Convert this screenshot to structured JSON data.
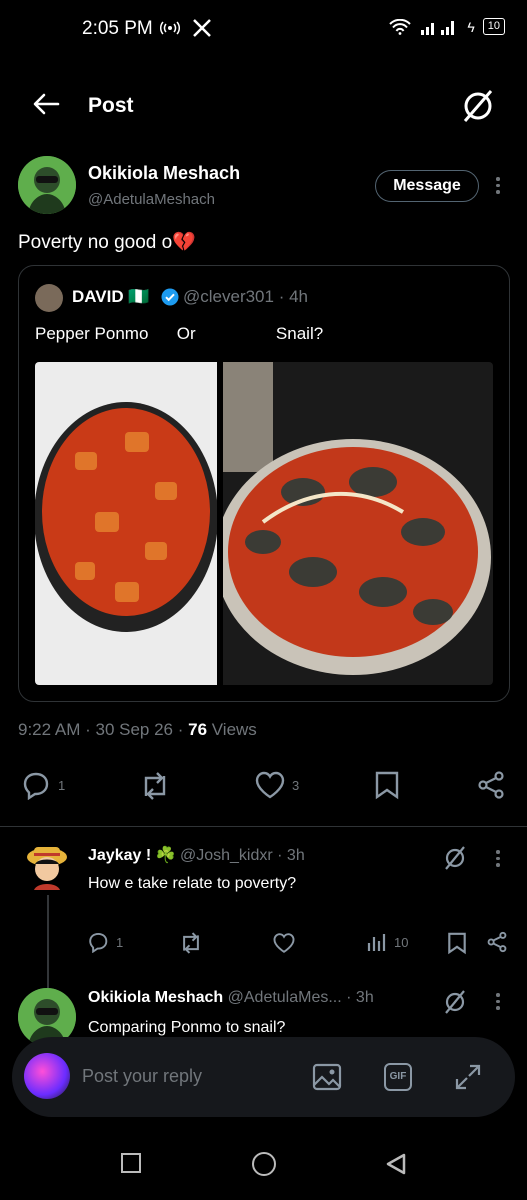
{
  "status_bar": {
    "time": "2:05 PM",
    "battery": "10"
  },
  "header": {
    "title": "Post"
  },
  "post": {
    "author_name": "Okikiola Meshach",
    "author_handle": "@AdetulaMeshach",
    "message_button": "Message",
    "text": "Poverty no good o💔",
    "quote": {
      "name": "DAVID 🇳🇬",
      "handle_time": "@clever301 · 4h",
      "text": "Pepper Ponmo      Or                 Snail?"
    },
    "time": "9:22 AM",
    "date": "30 Sep 26",
    "views_count": "76",
    "views_label": "Views",
    "replies": "1",
    "likes": "3"
  },
  "replies": [
    {
      "name": "Jaykay ! ☘️",
      "handle_time": "@Josh_kidxr · 3h",
      "text": "How e take relate to poverty?",
      "reply_count": "1",
      "views": "10"
    },
    {
      "name": "Okikiola Meshach",
      "handle_time": "@AdetulaMes... · 3h",
      "text": "Comparing Ponmo to snail?"
    }
  ],
  "reply_bar": {
    "placeholder": "Post your reply",
    "gif": "GIF"
  },
  "colors": {
    "background": "#000000",
    "text": "#e7e9ea",
    "muted": "#71767b",
    "accent_blue": "#1d9bf0",
    "border": "#2f3336"
  }
}
